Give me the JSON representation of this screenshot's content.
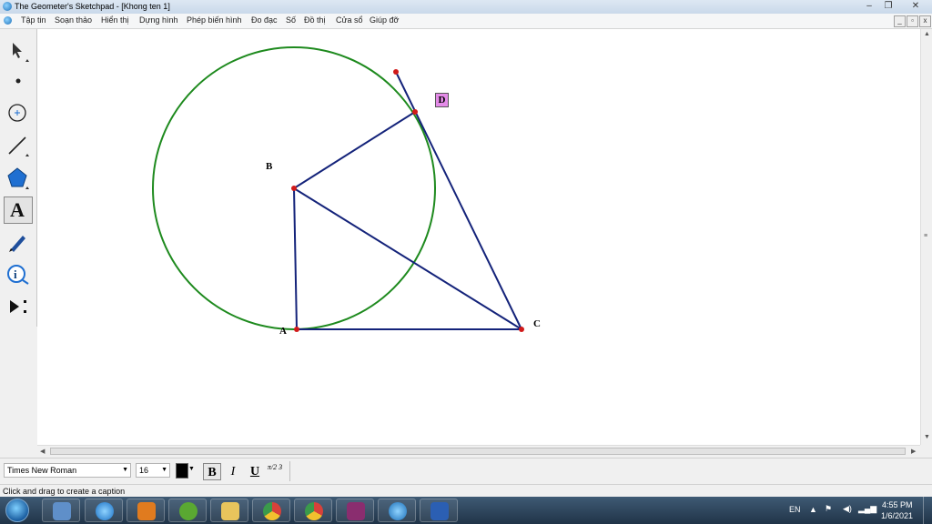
{
  "window": {
    "title": "The Geometer's Sketchpad - [Khong ten 1]",
    "controls": [
      "–",
      "❐",
      "✕"
    ],
    "mdi_controls": [
      "_",
      "▫",
      "x"
    ]
  },
  "menu": {
    "items": [
      "Tập tin",
      "Soạn thảo",
      "Hiển thị",
      "Dựng hình",
      "Phép biến hình",
      "Đo đạc",
      "Số",
      "Đồ thị",
      "Cửa sổ",
      "Giúp đỡ"
    ]
  },
  "toolbox": {
    "tools": [
      {
        "name": "arrow-select-tool"
      },
      {
        "name": "point-tool"
      },
      {
        "name": "compass-tool"
      },
      {
        "name": "straightedge-tool"
      },
      {
        "name": "polygon-tool"
      },
      {
        "name": "text-tool",
        "glyph": "A",
        "active": true
      },
      {
        "name": "marker-tool"
      },
      {
        "name": "information-tool",
        "glyph": "i"
      },
      {
        "name": "custom-tool"
      }
    ]
  },
  "sketch": {
    "labels": {
      "A": "A",
      "B": "B",
      "C": "C",
      "D": "D"
    },
    "colors": {
      "circle": "#1e8a1e",
      "segments": "#14237a",
      "points": "#d11a1a",
      "label_d_bg": "#e48be8"
    }
  },
  "text_toolbar": {
    "font": "Times New Roman",
    "size": "16",
    "bold": "B",
    "italic": "I",
    "underline": "U",
    "math_format": "π/2 3"
  },
  "status": {
    "text": "Click and drag to create a caption"
  },
  "taskbar": {
    "apps": [
      "control-panel",
      "internet-explorer",
      "media-player",
      "coc-coc",
      "file-explorer",
      "chrome-beta",
      "chrome",
      "winrar",
      "sketchpad",
      "word"
    ],
    "tray": {
      "lang": "EN",
      "time": "4:55 PM",
      "date": "1/6/2021"
    }
  }
}
